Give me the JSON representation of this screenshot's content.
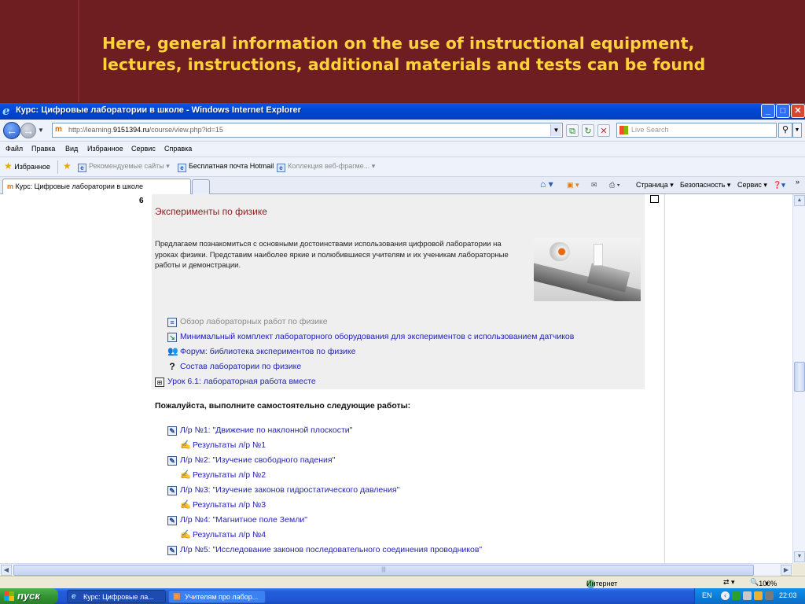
{
  "slide": {
    "title_line1": "Here, general information on the use of instructional equipment,",
    "title_line2": "lectures, instructions, additional materials and tests can be found"
  },
  "window": {
    "title": "Курс: Цифровые лаборатории в школе - Windows Internet Explorer",
    "address_prefix": "http://learning.",
    "address_domain": "9151394.ru",
    "address_path": "/course/view.php?id=15",
    "search_placeholder": "Live Search"
  },
  "menu": [
    "Файл",
    "Правка",
    "Вид",
    "Избранное",
    "Сервис",
    "Справка"
  ],
  "favorites_bar": {
    "favorites": "Избранное",
    "suggested": "Рекомендуемые сайты",
    "hotmail": "Бесплатная почта Hotmail",
    "webslices": "Коллекция веб-фрагме..."
  },
  "tab": {
    "title": "Курс: Цифровые лаборатории в школе"
  },
  "command_bar": {
    "page": "Страница",
    "safety": "Безопасность",
    "tools": "Сервис"
  },
  "section": {
    "number": "6",
    "title": "Эксперименты по физике",
    "description": "Предлагаем познакомиться с основными достоинствами использования цифровой лаборатории на уроках физики. Представим наиболее яркие и полюбившиеся учителям и их ученикам лабораторные работы и демонстрации.",
    "resources": [
      {
        "label": "Обзор лабораторных работ по физике",
        "icon": "page-icon"
      },
      {
        "label": "Минимальный комплект лабораторного оборудования для экспериментов с использованием датчиков",
        "icon": "file-icon"
      },
      {
        "label": "Форум: библиотека экспериментов по физике",
        "icon": "forum-icon"
      },
      {
        "label": "Состав лаборатории по физике",
        "icon": "question-icon"
      },
      {
        "label": "Урок 6.1: лабораторная работа вместе",
        "icon": "lesson-icon"
      }
    ],
    "prompt": "Пожалуйста, выполните самостоятельно следующие работы:",
    "assignments": [
      {
        "label": "Л/р №1: \"Движение по наклонной плоскости\"",
        "result": "Результаты л/р №1"
      },
      {
        "label": "Л/р №2: \"Изучение свободного падения\"",
        "result": "Результаты л/р №2"
      },
      {
        "label": "Л/р №3: \"Изучение законов гидростатического давления\"",
        "result": "Результаты л/р №3"
      },
      {
        "label": "Л/р №4: \"Магнитное поле Земли\"",
        "result": "Результаты л/р №4"
      },
      {
        "label": "Л/р №5: \"Исследование законов последовательного соединения проводников\"",
        "result": ""
      }
    ]
  },
  "status_bar": {
    "zone": "Интернет",
    "zoom": "100%"
  },
  "taskbar": {
    "start": "пуск",
    "task1": "Курс: Цифровые ла...",
    "task2": "Учителям про лабор...",
    "lang": "EN",
    "time": "22:03"
  }
}
